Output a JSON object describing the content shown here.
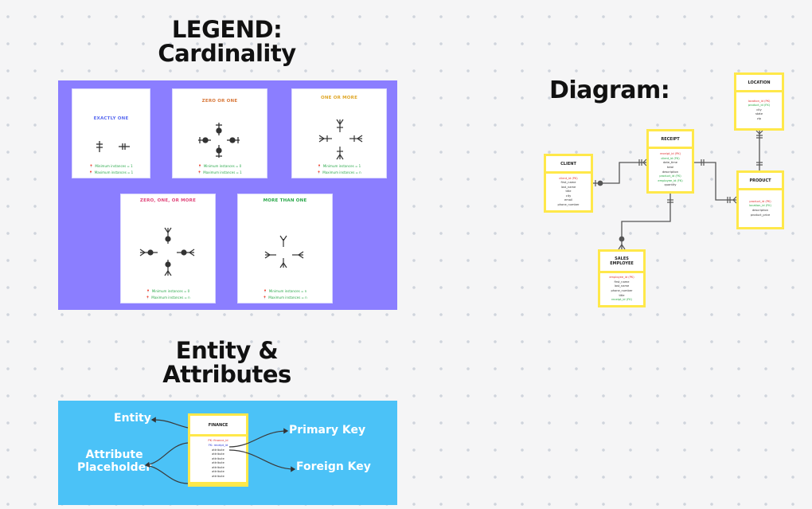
{
  "headings": {
    "legend_line1": "LEGEND:",
    "legend_line2": "Cardinality",
    "diagram": "Diagram:",
    "entity_line1": "Entity &",
    "entity_line2": "Attributes"
  },
  "colors": {
    "legend_panel": "#8b7eff",
    "entity_panel": "#4bc2f7",
    "entity_border": "#ffe84a",
    "primary_key": "#e0312f",
    "foreign_key": "#23a83f"
  },
  "cardinality_cards": [
    {
      "title": "EXACTLY ONE",
      "title_color": "#5b6cf0",
      "min_note": "Minimum instances = 1",
      "max_note": "Maximum instances = 1"
    },
    {
      "title": "ZERO OR ONE",
      "title_color": "#d8783a",
      "min_note": "Minimum instances = 0",
      "max_note": "Maximum instances = 1"
    },
    {
      "title": "ONE OR MORE",
      "title_color": "#e0a82a",
      "min_note": "Minimum instances = 1",
      "max_note": "Maximum instances = n"
    },
    {
      "title": "ZERO, ONE, OR MORE",
      "title_color": "#e0457a",
      "min_note": "Minimum instances = 0",
      "max_note": "Maximum instances = n"
    },
    {
      "title": "MORE THAN ONE",
      "title_color": "#2aa84a",
      "min_note": "Minimum instances = n",
      "max_note": "Maximum instances = n"
    }
  ],
  "entity_attributes": {
    "entity_label": "Entity",
    "attribute_label_line1": "Attribute",
    "attribute_label_line2": "Placeholder",
    "primary_key_label": "Primary Key",
    "foreign_key_label": "Foreign Key",
    "example_entity": {
      "name": "FINANCE",
      "attributes": [
        {
          "text": "PK: finance_id",
          "kind": "pk"
        },
        {
          "text": "FK: receipt_id",
          "kind": "fkb"
        },
        {
          "text": "attribute",
          "kind": "n"
        },
        {
          "text": "attribute",
          "kind": "n"
        },
        {
          "text": "attribute",
          "kind": "n"
        },
        {
          "text": "attribute",
          "kind": "n"
        },
        {
          "text": "attribute",
          "kind": "n"
        },
        {
          "text": "attribute",
          "kind": "n"
        },
        {
          "text": "attribute",
          "kind": "n"
        }
      ]
    }
  },
  "diagram_entities": {
    "client": {
      "name": "CLIENT",
      "attributes": [
        {
          "text": "client_id (PK)",
          "kind": "pk"
        },
        {
          "text": "first_name",
          "kind": "n"
        },
        {
          "text": "last_name",
          "kind": "n"
        },
        {
          "text": "title",
          "kind": "n"
        },
        {
          "text": "city",
          "kind": "n"
        },
        {
          "text": "email",
          "kind": "n"
        },
        {
          "text": "phone_number",
          "kind": "n"
        }
      ]
    },
    "receipt": {
      "name": "RECEIPT",
      "attributes": [
        {
          "text": "receipt_id (PK)",
          "kind": "pk"
        },
        {
          "text": "client_id (FK)",
          "kind": "fk"
        },
        {
          "text": "date_time",
          "kind": "n"
        },
        {
          "text": "total",
          "kind": "n"
        },
        {
          "text": "description",
          "kind": "n"
        },
        {
          "text": "product_id (FK)",
          "kind": "fk"
        },
        {
          "text": "employee_id (FK)",
          "kind": "fk"
        },
        {
          "text": "quantity",
          "kind": "n"
        }
      ]
    },
    "location": {
      "name": "LOCATION",
      "attributes": [
        {
          "text": "location_id (PK)",
          "kind": "pk"
        },
        {
          "text": "product_id (FK)",
          "kind": "fk"
        },
        {
          "text": "city",
          "kind": "n"
        },
        {
          "text": "state",
          "kind": "n"
        },
        {
          "text": "zip",
          "kind": "n"
        }
      ]
    },
    "product": {
      "name": "PRODUCT",
      "attributes": [
        {
          "text": "product_id (PK)",
          "kind": "pk"
        },
        {
          "text": "location_id (FK)",
          "kind": "fk"
        },
        {
          "text": "description",
          "kind": "n"
        },
        {
          "text": "product_price",
          "kind": "n"
        }
      ]
    },
    "sales_employee": {
      "name_line1": "SALES",
      "name_line2": "EMPLOYEE",
      "attributes": [
        {
          "text": "employee_id (PK)",
          "kind": "pk"
        },
        {
          "text": "first_name",
          "kind": "n"
        },
        {
          "text": "last_name",
          "kind": "n"
        },
        {
          "text": "phone_number",
          "kind": "n"
        },
        {
          "text": "title",
          "kind": "n"
        },
        {
          "text": "receipt_id (FK)",
          "kind": "fk"
        }
      ]
    }
  }
}
